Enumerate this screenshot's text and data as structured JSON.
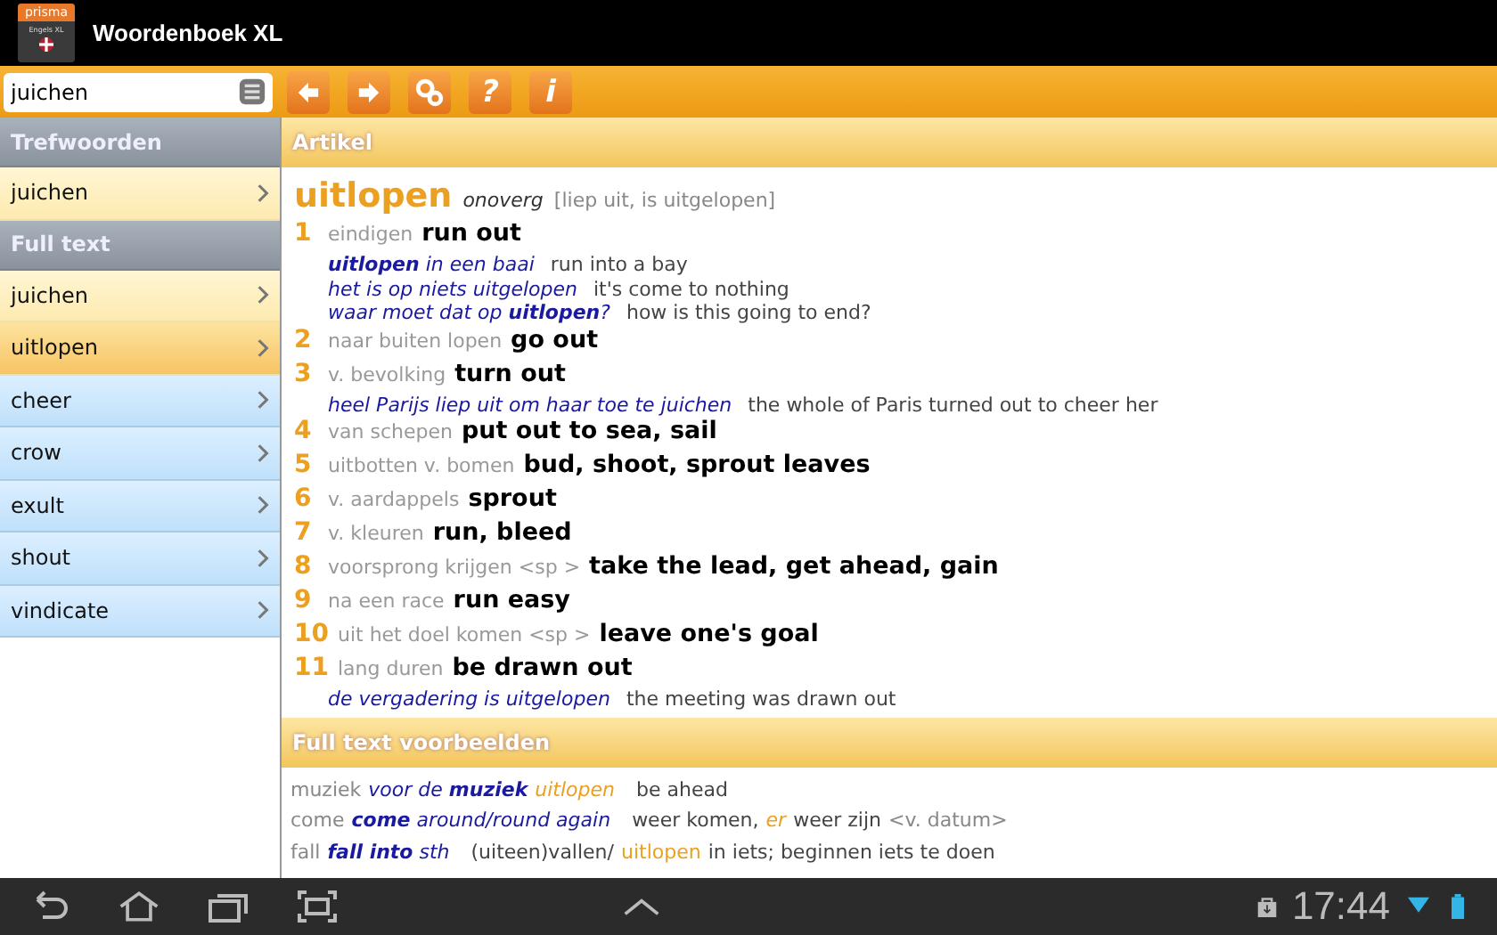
{
  "app_bar": {
    "logo": {
      "brand": "prisma",
      "subtitle": "Engels XL"
    },
    "title": "Woordenboek XL"
  },
  "toolbar": {
    "search": {
      "value": "juichen"
    },
    "buttons": [
      {
        "kind": "back"
      },
      {
        "kind": "forward"
      },
      {
        "kind": "gears"
      },
      {
        "kind": "char",
        "label": "?"
      },
      {
        "kind": "char",
        "label": "i"
      }
    ]
  },
  "sidebar": {
    "sections": [
      {
        "title": "Trefwoorden",
        "items": [
          {
            "label": "juichen",
            "kind": "dutch",
            "selected": false
          }
        ]
      },
      {
        "title": "Full text",
        "items": [
          {
            "label": "juichen",
            "kind": "dutch",
            "selected": false
          },
          {
            "label": "uitlopen",
            "kind": "dutch",
            "selected": true
          },
          {
            "label": "cheer",
            "kind": "english",
            "selected": false
          },
          {
            "label": "crow",
            "kind": "english",
            "selected": false
          },
          {
            "label": "exult",
            "kind": "english",
            "selected": false
          },
          {
            "label": "shout",
            "kind": "english",
            "selected": false
          },
          {
            "label": "vindicate",
            "kind": "english",
            "selected": false
          }
        ]
      }
    ]
  },
  "article": {
    "title": "Artikel",
    "headword": "uitlopen",
    "pos": "onoverg",
    "forms": "[liep uit, is uitgelopen]",
    "senses": [
      {
        "number": "1",
        "context": "eindigen",
        "translation": "run out",
        "examples": [
          {
            "nl": "**uitlopen** in een baai",
            "en": "run into a bay"
          },
          {
            "nl": "het is op niets uitgelopen",
            "en": "it's come to nothing"
          },
          {
            "nl": "waar moet dat op **uitlopen**?",
            "en": "how is this going to end?"
          }
        ]
      },
      {
        "number": "2",
        "context": "naar buiten lopen",
        "translation": "go out"
      },
      {
        "number": "3",
        "context": "v. bevolking",
        "translation": "turn out",
        "examples": [
          {
            "nl": "heel Parijs liep uit om haar toe te juichen",
            "en": "the whole of Paris turned out to cheer her"
          }
        ]
      },
      {
        "number": "4",
        "context": "van schepen",
        "translation": "put out to sea, sail"
      },
      {
        "number": "5",
        "context": "uitbotten v. bomen",
        "translation": "bud, shoot, sprout leaves"
      },
      {
        "number": "6",
        "context": "v. aardappels",
        "translation": "sprout"
      },
      {
        "number": "7",
        "context": "v. kleuren",
        "translation": "run, bleed"
      },
      {
        "number": "8",
        "context": "voorsprong krijgen <sp >",
        "translation": "take the lead, get ahead, gain"
      },
      {
        "number": "9",
        "context": "na een race",
        "translation": "run easy"
      },
      {
        "number": "10",
        "context": "uit het doel komen <sp >",
        "translation": "leave one's goal"
      },
      {
        "number": "11",
        "context": "lang duren",
        "translation": "be drawn out",
        "examples": [
          {
            "nl": "de vergadering is uitgelopen",
            "en": "the meeting was drawn out"
          }
        ]
      }
    ]
  },
  "full_text": {
    "title": "Full text voorbeelden",
    "lines": [
      [
        {
          "kind": "label",
          "text": "muziek"
        },
        {
          "kind": "phrase",
          "text": "voor de **muziek**"
        },
        {
          "kind": "hit",
          "text": "uitlopen"
        },
        {
          "kind": "gap"
        },
        {
          "kind": "trans",
          "text": "be ahead"
        }
      ],
      [
        {
          "kind": "label",
          "text": "come"
        },
        {
          "kind": "phrase",
          "text": "**come** around/round again"
        },
        {
          "kind": "gap"
        },
        {
          "kind": "trans",
          "text": "weer komen,"
        },
        {
          "kind": "hit",
          "text": "er"
        },
        {
          "kind": "trans",
          "text": "weer zijn"
        },
        {
          "kind": "label",
          "text": "<v. datum>"
        }
      ],
      [
        {
          "kind": "label",
          "text": "fall"
        },
        {
          "kind": "phrase",
          "text": "**fall into** sth"
        },
        {
          "kind": "gap"
        },
        {
          "kind": "trans",
          "text": "(uiteen)vallen/"
        },
        {
          "kind": "hitplain",
          "text": "uitlopen"
        },
        {
          "kind": "trans",
          "text": "in iets; beginnen iets te doen"
        }
      ]
    ]
  },
  "nav_bar": {
    "time": "17:44"
  }
}
